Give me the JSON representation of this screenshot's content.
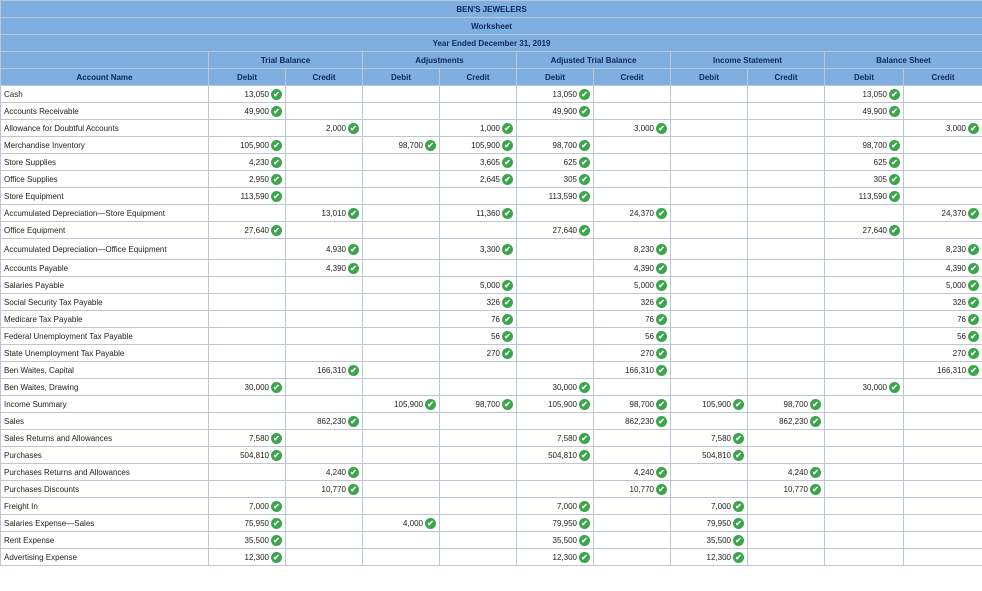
{
  "titles": [
    "BEN'S JEWELERS",
    "Worksheet",
    "Year Ended December 31, 2019"
  ],
  "sections": [
    "Trial Balance",
    "Adjustments",
    "Adjusted Trial Balance",
    "Income Statement",
    "Balance Sheet"
  ],
  "account_header": "Account Name",
  "debit_label": "Debit",
  "credit_label": "Credit",
  "check_icon": "check-circle-icon",
  "colors": {
    "header_bg": "#7faee0",
    "check": "#3aa54a"
  },
  "rows": [
    {
      "name": "Cash",
      "v": [
        "13,050",
        "",
        "",
        "",
        "13,050",
        "",
        "",
        "",
        "13,050",
        ""
      ]
    },
    {
      "name": "Accounts Receivable",
      "v": [
        "49,900",
        "",
        "",
        "",
        "49,900",
        "",
        "",
        "",
        "49,900",
        ""
      ]
    },
    {
      "name": "Allowance for Doubtful Accounts",
      "v": [
        "",
        "2,000",
        "",
        "1,000",
        "",
        "3,000",
        "",
        "",
        "",
        "3,000"
      ]
    },
    {
      "name": "Merchandise Inventory",
      "v": [
        "105,900",
        "",
        "98,700",
        "105,900",
        "98,700",
        "",
        "",
        "",
        "98,700",
        ""
      ]
    },
    {
      "name": "Store Supplies",
      "v": [
        "4,230",
        "",
        "",
        "3,605",
        "625",
        "",
        "",
        "",
        "625",
        ""
      ]
    },
    {
      "name": "Office Supplies",
      "v": [
        "2,950",
        "",
        "",
        "2,645",
        "305",
        "",
        "",
        "",
        "305",
        ""
      ]
    },
    {
      "name": "Store Equipment",
      "v": [
        "113,590",
        "",
        "",
        "",
        "113,590",
        "",
        "",
        "",
        "113,590",
        ""
      ]
    },
    {
      "name": "Accumulated Depreciation—Store Equipment",
      "v": [
        "",
        "13,010",
        "",
        "11,360",
        "",
        "24,370",
        "",
        "",
        "",
        "24,370"
      ]
    },
    {
      "name": "Office Equipment",
      "v": [
        "27,640",
        "",
        "",
        "",
        "27,640",
        "",
        "",
        "",
        "27,640",
        ""
      ]
    },
    {
      "name": "Accumulated Depreciation—Office Equipment",
      "v": [
        "",
        "4,930",
        "",
        "3,300",
        "",
        "8,230",
        "",
        "",
        "",
        "8,230"
      ],
      "tall": true
    },
    {
      "name": "Accounts Payable",
      "v": [
        "",
        "4,390",
        "",
        "",
        "",
        "4,390",
        "",
        "",
        "",
        "4,390"
      ]
    },
    {
      "name": "Salaries Payable",
      "v": [
        "",
        "",
        "",
        "5,000",
        "",
        "5,000",
        "",
        "",
        "",
        "5,000"
      ]
    },
    {
      "name": "Social Security Tax Payable",
      "v": [
        "",
        "",
        "",
        "326",
        "",
        "326",
        "",
        "",
        "",
        "326"
      ]
    },
    {
      "name": "Medicare Tax Payable",
      "v": [
        "",
        "",
        "",
        "76",
        "",
        "76",
        "",
        "",
        "",
        "76"
      ]
    },
    {
      "name": "Federal Unemployment Tax Payable",
      "v": [
        "",
        "",
        "",
        "56",
        "",
        "56",
        "",
        "",
        "",
        "56"
      ]
    },
    {
      "name": "State Unemployment Tax Payable",
      "v": [
        "",
        "",
        "",
        "270",
        "",
        "270",
        "",
        "",
        "",
        "270"
      ]
    },
    {
      "name": "Ben Waites, Capital",
      "v": [
        "",
        "166,310",
        "",
        "",
        "",
        "166,310",
        "",
        "",
        "",
        "166,310"
      ]
    },
    {
      "name": "Ben Waites, Drawing",
      "v": [
        "30,000",
        "",
        "",
        "",
        "30,000",
        "",
        "",
        "",
        "30,000",
        ""
      ]
    },
    {
      "name": "Income Summary",
      "v": [
        "",
        "",
        "105,900",
        "98,700",
        "105,900",
        "98,700",
        "105,900",
        "98,700",
        "",
        ""
      ]
    },
    {
      "name": "Sales",
      "v": [
        "",
        "862,230",
        "",
        "",
        "",
        "862,230",
        "",
        "862,230",
        "",
        ""
      ]
    },
    {
      "name": "Sales Returns and Allowances",
      "v": [
        "7,580",
        "",
        "",
        "",
        "7,580",
        "",
        "7,580",
        "",
        "",
        ""
      ]
    },
    {
      "name": "Purchases",
      "v": [
        "504,810",
        "",
        "",
        "",
        "504,810",
        "",
        "504,810",
        "",
        "",
        ""
      ]
    },
    {
      "name": "Purchases Returns and Allowances",
      "v": [
        "",
        "4,240",
        "",
        "",
        "",
        "4,240",
        "",
        "4,240",
        "",
        ""
      ]
    },
    {
      "name": "Purchases Discounts",
      "v": [
        "",
        "10,770",
        "",
        "",
        "",
        "10,770",
        "",
        "10,770",
        "",
        ""
      ]
    },
    {
      "name": "Freight In",
      "v": [
        "7,000",
        "",
        "",
        "",
        "7,000",
        "",
        "7,000",
        "",
        "",
        ""
      ]
    },
    {
      "name": "Salaries Expense—Sales",
      "v": [
        "75,950",
        "",
        "4,000",
        "",
        "79,950",
        "",
        "79,950",
        "",
        "",
        ""
      ]
    },
    {
      "name": "Rent Expense",
      "v": [
        "35,500",
        "",
        "",
        "",
        "35,500",
        "",
        "35,500",
        "",
        "",
        ""
      ]
    },
    {
      "name": "Advertising Expense",
      "v": [
        "12,300",
        "",
        "",
        "",
        "12,300",
        "",
        "12,300",
        "",
        "",
        ""
      ]
    }
  ]
}
